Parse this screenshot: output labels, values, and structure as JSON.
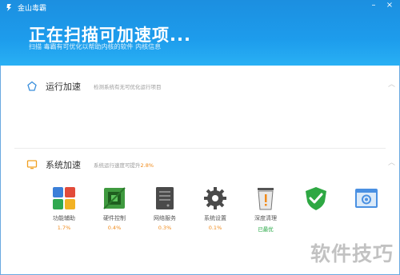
{
  "window": {
    "title": "金山毒霸"
  },
  "header": {
    "scan_title": "正在扫描可加速项...",
    "scan_subtitle": "扫描 毒霸有可优化以帮助内核的软件 内核信息"
  },
  "sections": {
    "run": {
      "title": "运行加速",
      "desc": "检测系统有无可优化运行项目"
    },
    "system": {
      "title": "系统加速",
      "desc_prefix": "系统运行速度可提升",
      "desc_value": "2.8%"
    }
  },
  "items": [
    {
      "label": "功能辅助",
      "value": "1.7%",
      "icon": "apps-icon"
    },
    {
      "label": "硬件控制",
      "value": "0.4%",
      "icon": "hardware-icon"
    },
    {
      "label": "网络服务",
      "value": "0.3%",
      "icon": "server-icon"
    },
    {
      "label": "系统设置",
      "value": "0.1%",
      "icon": "settings-gear-icon"
    },
    {
      "label": "深度清理",
      "value": "已最优",
      "icon": "trash-warning-icon"
    },
    {
      "label": "",
      "value": "",
      "icon": "shield-check-icon"
    },
    {
      "label": "",
      "value": "",
      "icon": "window-app-icon"
    }
  ],
  "colors": {
    "header_blue": "#1d9cec",
    "accent_orange": "#f08a1a",
    "ok_green": "#27a845"
  },
  "watermark": "软件技巧"
}
